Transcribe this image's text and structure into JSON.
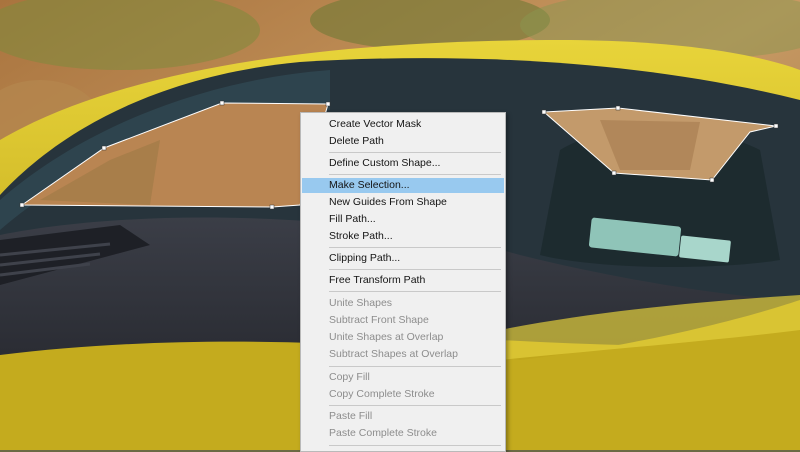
{
  "menu": {
    "items": [
      {
        "label": "Create Vector Mask",
        "enabled": true,
        "highlighted": false
      },
      {
        "label": "Delete Path",
        "enabled": true,
        "highlighted": false
      },
      {
        "label": "Define Custom Shape...",
        "enabled": true,
        "highlighted": false
      },
      {
        "label": "Make Selection...",
        "enabled": true,
        "highlighted": true
      },
      {
        "label": "New Guides From Shape",
        "enabled": true,
        "highlighted": false
      },
      {
        "label": "Fill Path...",
        "enabled": true,
        "highlighted": false
      },
      {
        "label": "Stroke Path...",
        "enabled": true,
        "highlighted": false
      },
      {
        "label": "Clipping Path...",
        "enabled": true,
        "highlighted": false
      },
      {
        "label": "Free Transform Path",
        "enabled": true,
        "highlighted": false
      },
      {
        "label": "Unite Shapes",
        "enabled": false,
        "highlighted": false
      },
      {
        "label": "Subtract Front Shape",
        "enabled": false,
        "highlighted": false
      },
      {
        "label": "Unite Shapes at Overlap",
        "enabled": false,
        "highlighted": false
      },
      {
        "label": "Subtract Shapes at Overlap",
        "enabled": false,
        "highlighted": false
      },
      {
        "label": "Copy Fill",
        "enabled": false,
        "highlighted": false
      },
      {
        "label": "Copy Complete Stroke",
        "enabled": false,
        "highlighted": false
      },
      {
        "label": "Paste Fill",
        "enabled": false,
        "highlighted": false
      },
      {
        "label": "Paste Complete Stroke",
        "enabled": false,
        "highlighted": false
      }
    ]
  },
  "colors": {
    "highlight": "#98c9ef",
    "path_stroke": "#ffffff",
    "car_body": "#d6c22a"
  }
}
